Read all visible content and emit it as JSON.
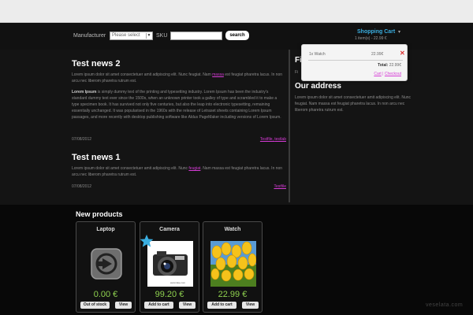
{
  "search": {
    "manufacturer_label": "Manufacturer",
    "manufacturer_value": "Please select",
    "sku_label": "SKU",
    "sku_value": "",
    "button_label": "search"
  },
  "cart": {
    "title": "Shopping Cart",
    "caret": "▾",
    "count_text": "1 item(s) - 22.99 €",
    "popup": {
      "item_name": "1x Watch",
      "item_price": "22.99€",
      "remove": "✕",
      "total_label": "Total:",
      "total_value": "22.99€",
      "cart_link": "Cart",
      "separator": " | ",
      "checkout_link": "Checkout"
    }
  },
  "news": [
    {
      "title": "Test news 2",
      "intro": "Lorem ipsum dolor sit amet consectetuer amit adipiscing elit. Nunc feugiat. Nam ",
      "intro_link": "massa",
      "intro_rest": " est feugiat pharetra lacus. In non arcu nec liberom pharetra rutrum est.",
      "body_strong": "Lorem Ipsum",
      "body": " is simply dummy text of the printing and typesetting industry. Lorem Ipsum has been the industry's standard dummy text ever since the 1500s, when an unknown printer took a galley of type and scrambled it to make a type specimen book. It has survived not only five centuries, but also the leap into electronic typesetting, remaining essentially unchanged. It was popularised in the 1960s with the release of Letraset sheets containing Lorem Ipsum passages, and more recently with desktop publishing software like Aldus PageMaker including versions of Lorem Ipsum.",
      "date": "07/08/2012",
      "tag1": "Testfile",
      "tag_sep": ", ",
      "tag2": "testlab"
    },
    {
      "title": "Test news 1",
      "intro": "Lorem ipsum dolor sit amet consectetuer amit adipiscing elit. Nunc ",
      "intro_link": "feugiat",
      "intro_rest": ". Nam massa est feugiat pharetra lacus. In non arcu nec liberom pharetra rutrum est.",
      "date": "07/08/2012",
      "tag1": "Testfile"
    }
  ],
  "sidebar": {
    "first_title": "Fi",
    "first_text": "Fi",
    "address_title": "Our address",
    "address_text": "Lorem ipsum dolor sit amet consectetuer amit adipiscing elit. Nunc feugiat. Nam massa est feugiat pharetra lacus. In non arcu nec liberom pharetra rutrum est."
  },
  "products": {
    "title": "New products",
    "items": [
      {
        "name": "Laptop",
        "price": "0.00 €",
        "button1": "Out of stock",
        "button2": "View",
        "image_icon": "no-image-icon"
      },
      {
        "name": "Camera",
        "price": "99.20 €",
        "button1": "Add to cart",
        "button2": "View",
        "image_icon": "camera-photo",
        "image_caption": "www.luke.com"
      },
      {
        "name": "Watch",
        "price": "22.99 €",
        "button1": "Add to cart",
        "button2": "View",
        "image_icon": "tulips-photo"
      }
    ]
  },
  "watermark": "veselata.com",
  "colors": {
    "accent_cart": "#3aaee0",
    "link": "#d63bd6",
    "price": "#8fd14f",
    "star": "#3aaee0"
  }
}
